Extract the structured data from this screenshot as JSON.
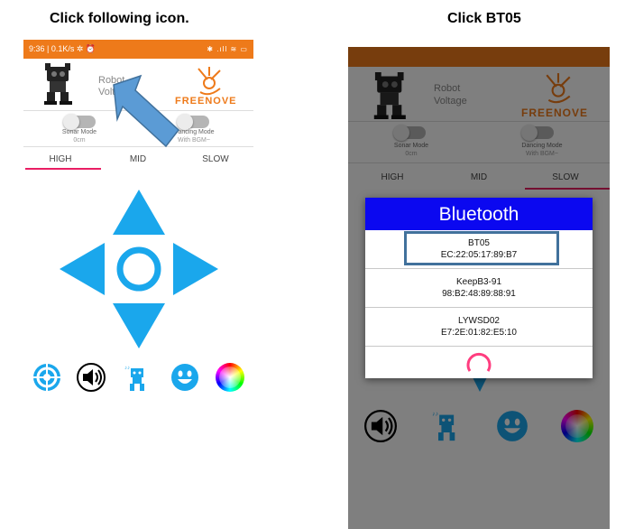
{
  "captions": {
    "left": "Click following icon.",
    "right": "Click BT05"
  },
  "phone": {
    "status": {
      "time": "9:36 | 0.1K/s ✲ ⏰",
      "right": "✱ .ıll ≋ ▭"
    },
    "robot_label": "Robot",
    "voltage_label": "Voltage",
    "voltage_short": "Voltag",
    "brand": "FREENOVE",
    "sonar": {
      "label": "Sonar Mode",
      "value": "0cm"
    },
    "dancing": {
      "label": "Dancing Mode",
      "value": "With BGM~"
    },
    "tabs": [
      "HIGH",
      "MID",
      "SLOW"
    ]
  },
  "bluetooth": {
    "title": "Bluetooth",
    "devices": [
      {
        "name": "BT05",
        "mac": "EC:22:05:17:89:B7"
      },
      {
        "name": "KeepB3-91",
        "mac": "98:B2:48:89:88:91"
      },
      {
        "name": "LYWSD02",
        "mac": "E7:2E:01:82:E5:10"
      }
    ]
  },
  "colors": {
    "orange": "#ee7a1a",
    "blue": "#1aa7ec",
    "dialog_blue": "#0b08f0",
    "tab_pink": "#e91e63"
  },
  "icons": [
    "target-icon",
    "volume-icon",
    "robot-dance-icon",
    "smile-icon",
    "color-wheel-icon"
  ]
}
